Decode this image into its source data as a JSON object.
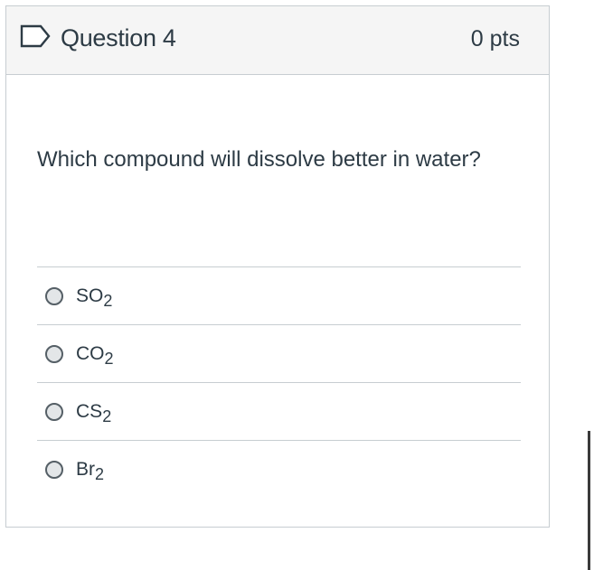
{
  "question": {
    "title": "Question 4",
    "points": "0 pts",
    "text": "Which compound will dissolve better in water?"
  },
  "answers": [
    {
      "base": "SO",
      "sub": "2"
    },
    {
      "base": "CO",
      "sub": "2"
    },
    {
      "base": "CS",
      "sub": "2"
    },
    {
      "base": "Br",
      "sub": "2"
    }
  ],
  "icons": {
    "flag": "flag-icon"
  },
  "colors": {
    "header_bg": "#f5f5f5",
    "border": "#c7cdd1",
    "text": "#2d3b45"
  }
}
